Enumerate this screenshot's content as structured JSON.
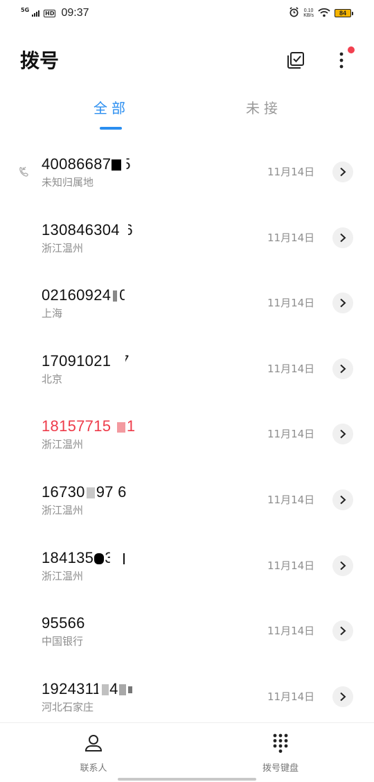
{
  "status_bar": {
    "network": "5G",
    "hd": "HD",
    "time": "09:37",
    "speed_value": "0.10",
    "speed_unit": "KB/s",
    "battery": "84"
  },
  "header": {
    "title": "拨号"
  },
  "tabs": [
    {
      "label": "全部",
      "active": true
    },
    {
      "label": "未接",
      "active": false
    }
  ],
  "calls": [
    {
      "number_start": "40086687",
      "number_end": "5",
      "location": "未知归属地",
      "date": "11月14日",
      "missed": false,
      "has_call_icon": true
    },
    {
      "number_start": "1308463041",
      "number_end": "6",
      "location": "浙江温州",
      "date": "11月14日",
      "missed": false,
      "has_call_icon": false
    },
    {
      "number_start": "02160924",
      "number_end": "0",
      "location": "上海",
      "date": "11月14日",
      "missed": false,
      "has_call_icon": false
    },
    {
      "number_start": "17091021",
      "number_end": "7",
      "location": "北京",
      "date": "11月14日",
      "missed": false,
      "has_call_icon": false
    },
    {
      "number_start": "181577151",
      "number_end": "1",
      "location": "浙江温州",
      "date": "11月14日",
      "missed": true,
      "has_call_icon": false
    },
    {
      "number_start": "16730",
      "number_end": "97 6",
      "location": "浙江温州",
      "date": "11月14日",
      "missed": false,
      "has_call_icon": false
    },
    {
      "number_start": "184135",
      "number_end": "3",
      "location": "浙江温州",
      "date": "11月14日",
      "missed": false,
      "has_call_icon": false
    },
    {
      "number_start": "95566",
      "number_end": "",
      "location": "中国银行",
      "date": "11月14日",
      "missed": false,
      "has_call_icon": false
    },
    {
      "number_start": "1924311",
      "number_end": "4",
      "location": "河北石家庄",
      "date": "11月14日",
      "missed": false,
      "has_call_icon": false
    }
  ],
  "bottom_nav": [
    {
      "label": "联系人",
      "icon": "person-icon"
    },
    {
      "label": "拨号键盘",
      "icon": "dialpad-icon"
    }
  ],
  "colors": {
    "accent": "#2a8ef0",
    "missed": "#ee3b4a",
    "secondary_text": "#8e8e8e",
    "notification_dot": "#f2404f",
    "battery": "#f5b400"
  }
}
